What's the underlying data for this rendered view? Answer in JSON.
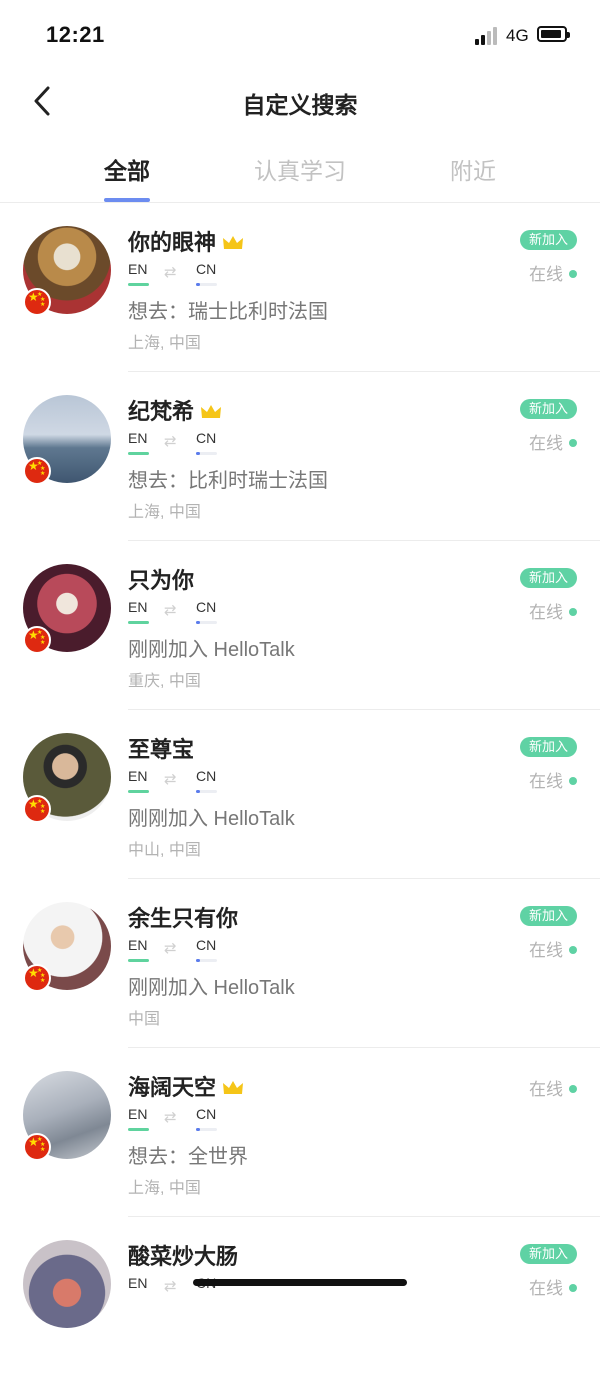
{
  "status_bar": {
    "time": "12:21",
    "network": "4G"
  },
  "nav": {
    "title": "自定义搜索"
  },
  "tabs": [
    {
      "label": "全部",
      "active": true
    },
    {
      "label": "认真学习",
      "active": false
    },
    {
      "label": "附近",
      "active": false
    }
  ],
  "users": [
    {
      "name": "你的眼神",
      "vip": true,
      "native": "EN",
      "learning": "CN",
      "line": "想去：瑞士比利时法国",
      "location": "上海, 中国",
      "badge": "新加入",
      "status": "在线"
    },
    {
      "name": "纪梵希",
      "vip": true,
      "native": "EN",
      "learning": "CN",
      "line": "想去：比利时瑞士法国",
      "location": "上海, 中国",
      "badge": "新加入",
      "status": "在线"
    },
    {
      "name": "只为你",
      "vip": false,
      "native": "EN",
      "learning": "CN",
      "line": "刚刚加入 HelloTalk",
      "location": "重庆, 中国",
      "badge": "新加入",
      "status": "在线"
    },
    {
      "name": "至尊宝",
      "vip": false,
      "native": "EN",
      "learning": "CN",
      "line": "刚刚加入 HelloTalk",
      "location": "中山, 中国",
      "badge": "新加入",
      "status": "在线"
    },
    {
      "name": "余生只有你",
      "vip": false,
      "native": "EN",
      "learning": "CN",
      "line": "刚刚加入 HelloTalk",
      "location": "中国",
      "badge": "新加入",
      "status": "在线"
    },
    {
      "name": "海阔天空",
      "vip": true,
      "native": "EN",
      "learning": "CN",
      "line": "想去：全世界",
      "location": "上海, 中国",
      "badge": "",
      "status": "在线"
    },
    {
      "name": "酸菜炒大肠",
      "vip": false,
      "native": "EN",
      "learning": "CN",
      "line": "",
      "location": "",
      "badge": "新加入",
      "status": "在线"
    }
  ],
  "colors": {
    "accent_green": "#5fd2a4",
    "tab_indicator": "#6c8cf0",
    "flag_red": "#de2910",
    "crown": "#f5c518"
  },
  "icons": {
    "back": "chevron-left-icon",
    "swap": "swap-arrows-icon",
    "vip": "crown-icon",
    "flag": "china-flag-icon"
  }
}
